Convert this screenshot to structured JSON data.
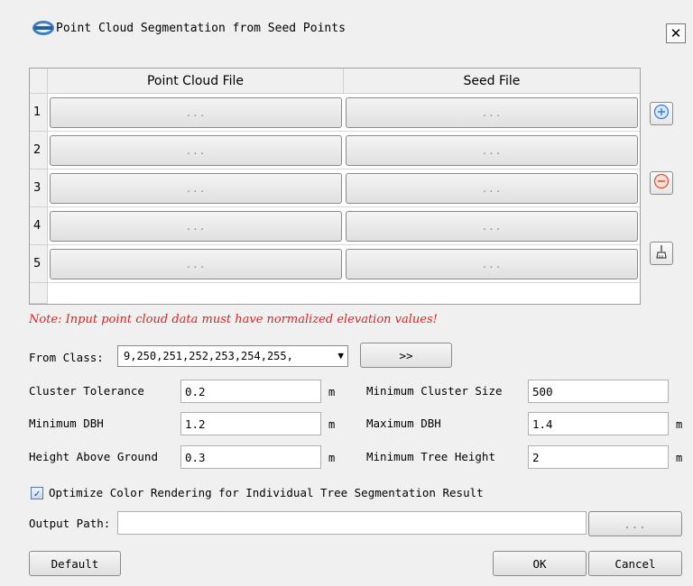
{
  "window": {
    "title": "Point Cloud Segmentation from Seed Points"
  },
  "table": {
    "columns": [
      "Point Cloud File",
      "Seed File"
    ],
    "rows": [
      {
        "num": "1",
        "pc": "...",
        "seed": "..."
      },
      {
        "num": "2",
        "pc": "...",
        "seed": "..."
      },
      {
        "num": "3",
        "pc": "...",
        "seed": "..."
      },
      {
        "num": "4",
        "pc": "...",
        "seed": "..."
      },
      {
        "num": "5",
        "pc": "...",
        "seed": "..."
      }
    ]
  },
  "side_buttons": [
    "add-icon",
    "remove-icon",
    "clear-brush-icon"
  ],
  "note": "Note: Input point cloud data must have normalized elevation values!",
  "from_class": {
    "label": "From Class:",
    "value": "9,250,251,252,253,254,255,",
    "select_label": ">>"
  },
  "params": {
    "cluster_tolerance": {
      "label": "Cluster Tolerance",
      "value": "0.2",
      "unit": "m"
    },
    "min_cluster_size": {
      "label": "Minimum Cluster Size",
      "value": "500"
    },
    "min_dbh": {
      "label": "Minimum DBH",
      "value": "1.2",
      "unit": "m"
    },
    "max_dbh": {
      "label": "Maximum DBH",
      "value": "1.4",
      "unit": "m"
    },
    "height_above_ground": {
      "label": "Height Above Ground",
      "value": "0.3",
      "unit": "m"
    },
    "min_tree_height": {
      "label": "Minimum Tree Height",
      "value": "2",
      "unit": "m"
    }
  },
  "optimize": {
    "label": "Optimize Color Rendering for Individual Tree Segmentation Result",
    "checked": true,
    "mark": "✓"
  },
  "output": {
    "label": "Output Path:",
    "value": "",
    "browse_label": "..."
  },
  "buttons": {
    "default": "Default",
    "ok": "OK",
    "cancel": "Cancel",
    "close": "✕"
  },
  "colors": {
    "note": "#e02020",
    "add": "#3a7bd5",
    "remove": "#e0502e"
  }
}
